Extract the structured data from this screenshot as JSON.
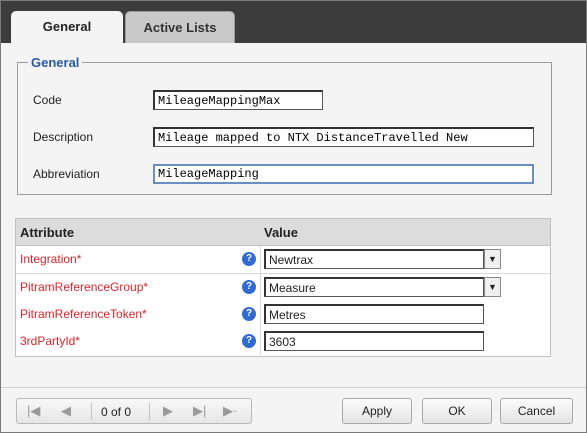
{
  "tabs": [
    {
      "label": "General",
      "active": true
    },
    {
      "label": "Active Lists",
      "active": false
    }
  ],
  "general_group": {
    "legend": "General",
    "fields": [
      {
        "label": "Code",
        "value": "MileageMappingMax"
      },
      {
        "label": "Description",
        "value": "Mileage mapped to NTX DistanceTravelled New"
      },
      {
        "label": "Abbreviation",
        "value": "MileageMapping"
      }
    ]
  },
  "attributes_grid": {
    "headers": {
      "attribute": "Attribute",
      "value": "Value"
    },
    "rows": [
      {
        "name": "Integration*",
        "value": "Newtrax",
        "type": "combo"
      },
      {
        "name": "PitramReferenceGroup*",
        "value": "Measure",
        "type": "combo"
      },
      {
        "name": "PitramReferenceToken*",
        "value": "Metres",
        "type": "text"
      },
      {
        "name": "3rdPartyId*",
        "value": "3603",
        "type": "text"
      }
    ],
    "help_glyph": "?"
  },
  "pager": {
    "count_text": "0 of 0",
    "glyphs": {
      "first": "|◀",
      "prev": "◀",
      "next": "▶",
      "last": "▶|",
      "extra": "▶·"
    }
  },
  "buttons": {
    "apply": "Apply",
    "ok": "OK",
    "cancel": "Cancel"
  },
  "icons": {
    "help": "help-icon",
    "dropdown": "chevron-down-icon"
  },
  "colors": {
    "required_label": "#d8262d",
    "legend": "#2a5a9c",
    "help_icon": "#2f6bd0",
    "tabbar": "#3c3c3c"
  }
}
